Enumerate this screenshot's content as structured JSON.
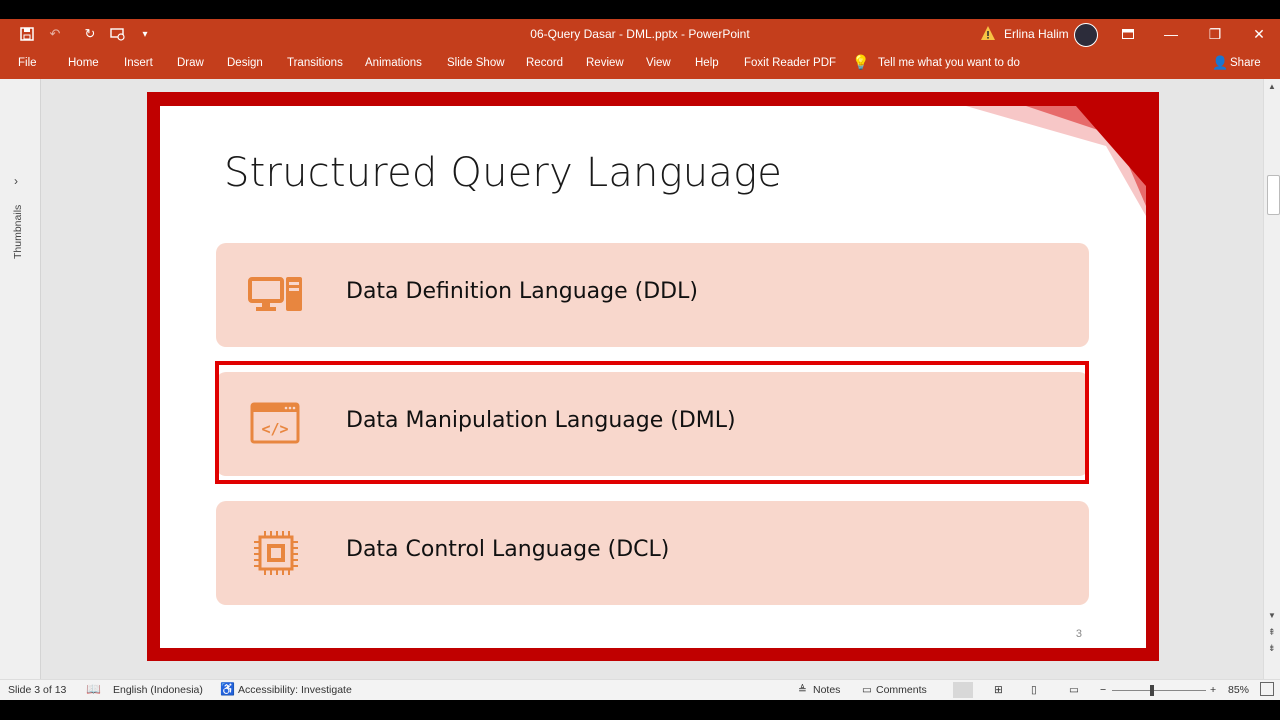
{
  "app": {
    "window_title": "06-Query Dasar - DML.pptx  -  PowerPoint",
    "user_name": "Erlina Halim"
  },
  "ribbon": {
    "tabs": [
      "File",
      "Home",
      "Insert",
      "Draw",
      "Design",
      "Transitions",
      "Animations",
      "Slide Show",
      "Record",
      "Review",
      "View",
      "Help",
      "Foxit Reader PDF"
    ],
    "tell_me": "Tell me what you want to do",
    "share": "Share"
  },
  "thumbnails": {
    "label": "Thumbnails"
  },
  "slide": {
    "title": "Structured Query Language",
    "items": [
      {
        "label": "Data Definition Language (DDL)",
        "icon": "computer-icon"
      },
      {
        "label": "Data Manipulation Language (DML)",
        "icon": "code-window-icon"
      },
      {
        "label": "Data Control Language (DCL)",
        "icon": "chip-icon"
      }
    ],
    "page_number": "3"
  },
  "status": {
    "slide_info": "Slide 3 of 13",
    "language": "English (Indonesia)",
    "accessibility": "Accessibility: Investigate",
    "notes": "Notes",
    "comments": "Comments",
    "zoom": "85%"
  },
  "colors": {
    "accent": "#c43e1c",
    "frame": "#c00000",
    "card": "#f8d7cc",
    "icon": "#e8863f"
  }
}
